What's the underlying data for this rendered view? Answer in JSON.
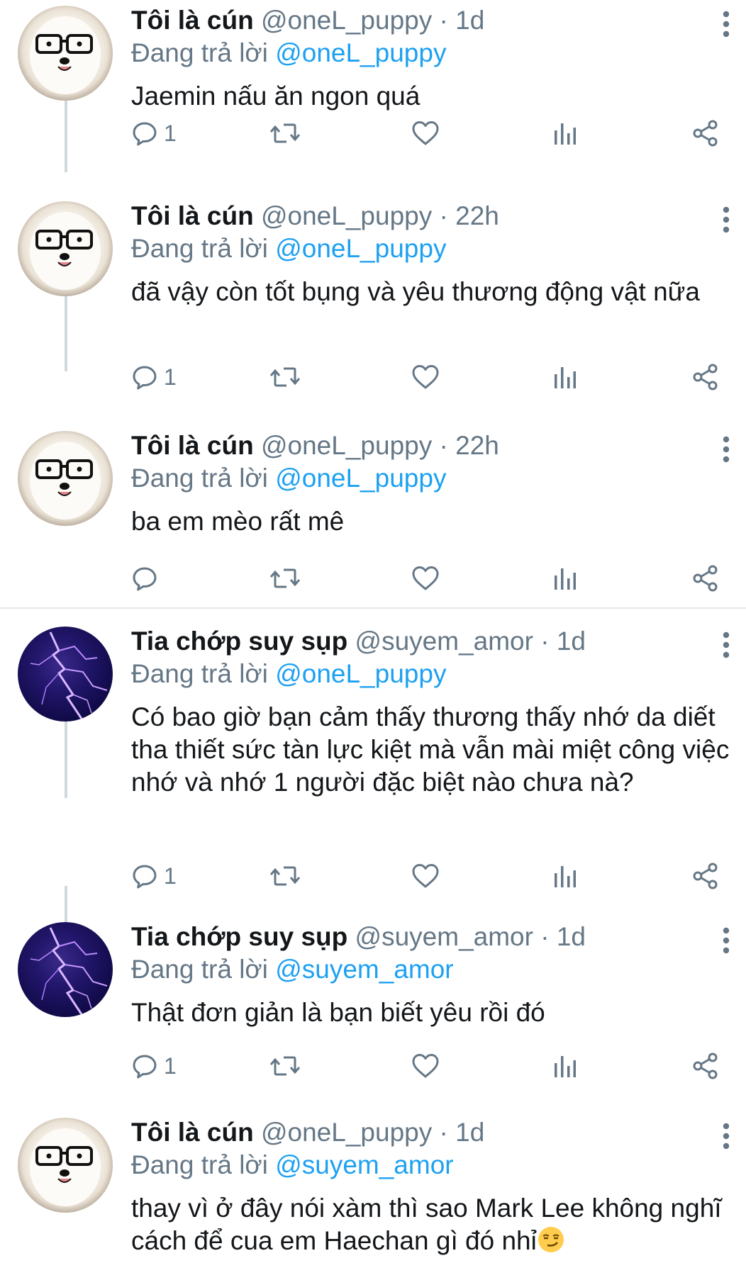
{
  "tweets": [
    {
      "name": "Tôi là cún",
      "handle": "@oneL_puppy",
      "dot": "·",
      "time": "1d",
      "reply_prefix": "Đang trả lời ",
      "reply_to": "@oneL_puppy",
      "text": "Jaemin nấu ăn ngon quá",
      "reply_count": "1",
      "avatar": "dog-avatar"
    },
    {
      "name": "Tôi là cún",
      "handle": "@oneL_puppy",
      "dot": "·",
      "time": "22h",
      "reply_prefix": "Đang trả lời ",
      "reply_to": "@oneL_puppy",
      "text": "đã vậy còn tốt bụng và yêu thương động vật nữa",
      "reply_count": "1",
      "avatar": "dog-avatar"
    },
    {
      "name": "Tôi là cún",
      "handle": "@oneL_puppy",
      "dot": "·",
      "time": "22h",
      "reply_prefix": "Đang trả lời ",
      "reply_to": "@oneL_puppy",
      "text": "ba em mèo rất mê",
      "reply_count": "",
      "avatar": "dog-avatar"
    },
    {
      "name": "Tia chớp suy sụp",
      "handle": "@suyem_amor",
      "dot": "·",
      "time": "1d",
      "reply_prefix": "Đang trả lời ",
      "reply_to": "@oneL_puppy",
      "text": "Có bao giờ bạn cảm thấy thương thấy nhớ da diết tha thiết sức tàn lực kiệt mà vẫn mài miệt công việc nhớ và nhớ 1 người đặc biệt nào chưa nà?",
      "reply_count": "1",
      "avatar": "lightning-avatar"
    },
    {
      "name": "Tia chớp suy sụp",
      "handle": "@suyem_amor",
      "dot": "·",
      "time": "1d",
      "reply_prefix": "Đang trả lời ",
      "reply_to": "@suyem_amor",
      "text": "Thật đơn giản là bạn biết yêu rồi đó",
      "reply_count": "1",
      "avatar": "lightning-avatar"
    },
    {
      "name": "Tôi là cún",
      "handle": "@oneL_puppy",
      "dot": "·",
      "time": "1d",
      "reply_prefix": "Đang trả lời ",
      "reply_to": "@suyem_amor",
      "text": "thay vì ở đây nói xàm thì sao Mark Lee không nghĩ cách để cua em Haechan gì đó nhỉ",
      "emoji": "smirking-face-emoji",
      "reply_count": "",
      "avatar": "dog-avatar"
    }
  ],
  "icons": {
    "reply": "reply-icon",
    "retweet": "retweet-icon",
    "like": "heart-icon",
    "analytics": "analytics-icon",
    "share": "share-icon",
    "more": "more-vertical-icon"
  },
  "colors": {
    "link": "#1da1f2",
    "secondary_text": "#657786",
    "primary_text": "#14171a",
    "thread_line": "#cfd9de"
  }
}
